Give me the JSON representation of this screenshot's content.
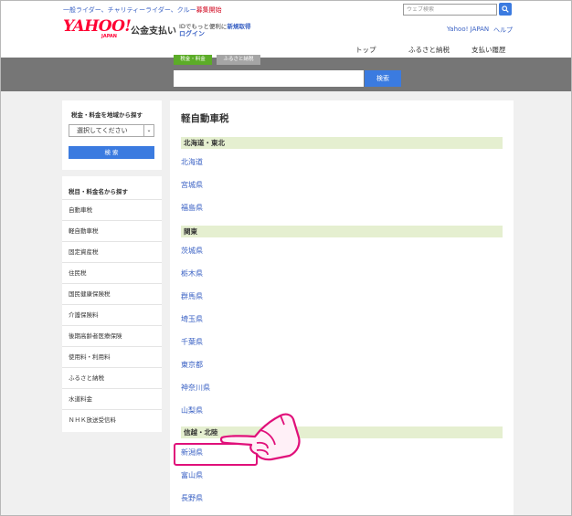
{
  "header": {
    "promo_links": "一般ライダー、チャリティーライダー、クルー",
    "promo_hot": "募集開始",
    "top_search_placeholder": "ウェブ検索",
    "logo": "YAHOO!",
    "logo_sub": "JAPAN",
    "service_name": "公金支払い",
    "login_note": "IDでもっと便利に",
    "login_note_link": "新規取得",
    "login_link": "ログイン",
    "yahoo_japan_link": "Yahoo! JAPAN",
    "help_link": "ヘルプ",
    "nav": [
      "トップ",
      "ふるさと納税",
      "支払い履歴"
    ]
  },
  "search": {
    "tabs": [
      "税金・料金",
      "ふるさと納税"
    ],
    "button": "検索"
  },
  "sidebar": {
    "region_title": "税金・料金を地域から探す",
    "select_value": "選択してください",
    "search_button": "検 索",
    "category_title": "税目・料金名から探す",
    "categories": [
      "自動車税",
      "軽自動車税",
      "固定資産税",
      "住民税",
      "国民健康保険税",
      "介護保険料",
      "後期高齢者医療保険",
      "使用料・利用料",
      "ふるさと納税",
      "水道料金",
      "ＮＨＫ放送受信料"
    ]
  },
  "main": {
    "title": "軽自動車税",
    "regions": [
      {
        "name": "北海道・東北",
        "prefectures": [
          "北海道",
          "宮城県",
          "福島県"
        ]
      },
      {
        "name": "関東",
        "prefectures": [
          "茨城県",
          "栃木県",
          "群馬県",
          "埼玉県",
          "千葉県",
          "東京都",
          "神奈川県",
          "山梨県"
        ]
      },
      {
        "name": "信越・北陸",
        "prefectures": [
          "新潟県",
          "富山県",
          "長野県"
        ]
      }
    ]
  },
  "colors": {
    "accent_blue": "#3b7be0",
    "link_blue": "#3b62c4",
    "brand_red": "#ff0033",
    "region_head_bg": "#e5efd0",
    "highlight_pink": "#e0107a"
  }
}
